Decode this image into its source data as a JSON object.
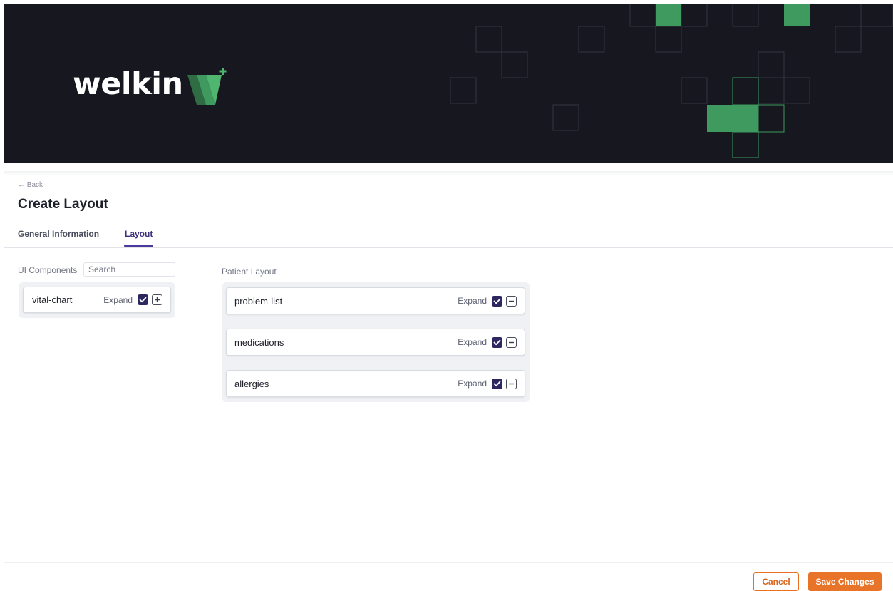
{
  "brand": {
    "logo_text": "welkin",
    "banner_color": "#16171f",
    "accent_green": "#3e9a5e"
  },
  "nav": {
    "back_label": "← Back"
  },
  "page": {
    "title": "Create Layout"
  },
  "tabs": [
    {
      "label": "General Information",
      "active": false
    },
    {
      "label": "Layout",
      "active": true
    }
  ],
  "ui_components": {
    "label": "UI Components",
    "search_placeholder": "Search",
    "items": [
      {
        "name": "vital-chart",
        "expand_label": "Expand",
        "expanded": true,
        "action_icon": "plus-icon"
      }
    ]
  },
  "patient_layout": {
    "label": "Patient Layout",
    "items": [
      {
        "name": "problem-list",
        "expand_label": "Expand",
        "expanded": true,
        "action_icon": "minus-icon"
      },
      {
        "name": "medications",
        "expand_label": "Expand",
        "expanded": true,
        "action_icon": "minus-icon"
      },
      {
        "name": "allergies",
        "expand_label": "Expand",
        "expanded": true,
        "action_icon": "minus-icon"
      }
    ]
  },
  "footer": {
    "cancel_label": "Cancel",
    "save_label": "Save Changes",
    "accent_color": "#e8742a"
  }
}
